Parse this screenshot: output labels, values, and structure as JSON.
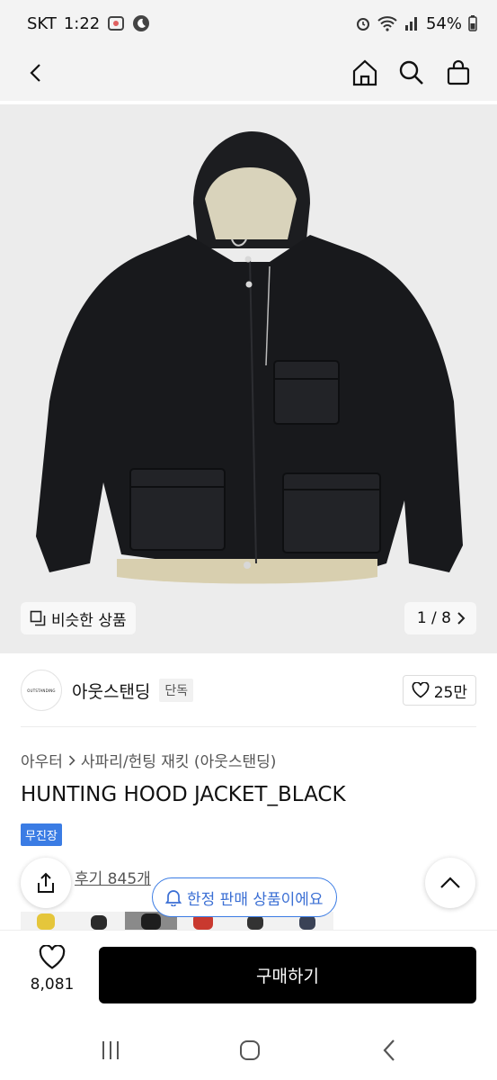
{
  "status_bar": {
    "carrier": "SKT",
    "time": "1:22",
    "battery": "54%",
    "icons": [
      "photo-icon",
      "moon-icon",
      "alarm-icon",
      "wifi-icon",
      "signal-icon",
      "battery-icon"
    ]
  },
  "header": {
    "icons": [
      "back-icon",
      "home-icon",
      "search-icon",
      "shopping-bag-icon"
    ]
  },
  "hero": {
    "similar_label": "비슷한 상품",
    "page_indicator": "1 / 8"
  },
  "brand": {
    "logo_text": "OUTSTANDING",
    "name": "아웃스탠딩",
    "badge": "단독",
    "likes": "25만"
  },
  "product": {
    "breadcrumb": [
      "아우터",
      "사파리/헌팅 재킷 (아웃스탠딩)"
    ],
    "title": "HUNTING HOOD JACKET_BLACK",
    "shipping_badge": "무진장",
    "reviews": "후기 845개",
    "limited_notice": "한정 판매 상품이에요"
  },
  "bottom_bar": {
    "wish_count": "8,081",
    "buy_label": "구매하기"
  },
  "colors": {
    "accent_blue": "#3b7ce4",
    "buy_button": "#000000"
  }
}
